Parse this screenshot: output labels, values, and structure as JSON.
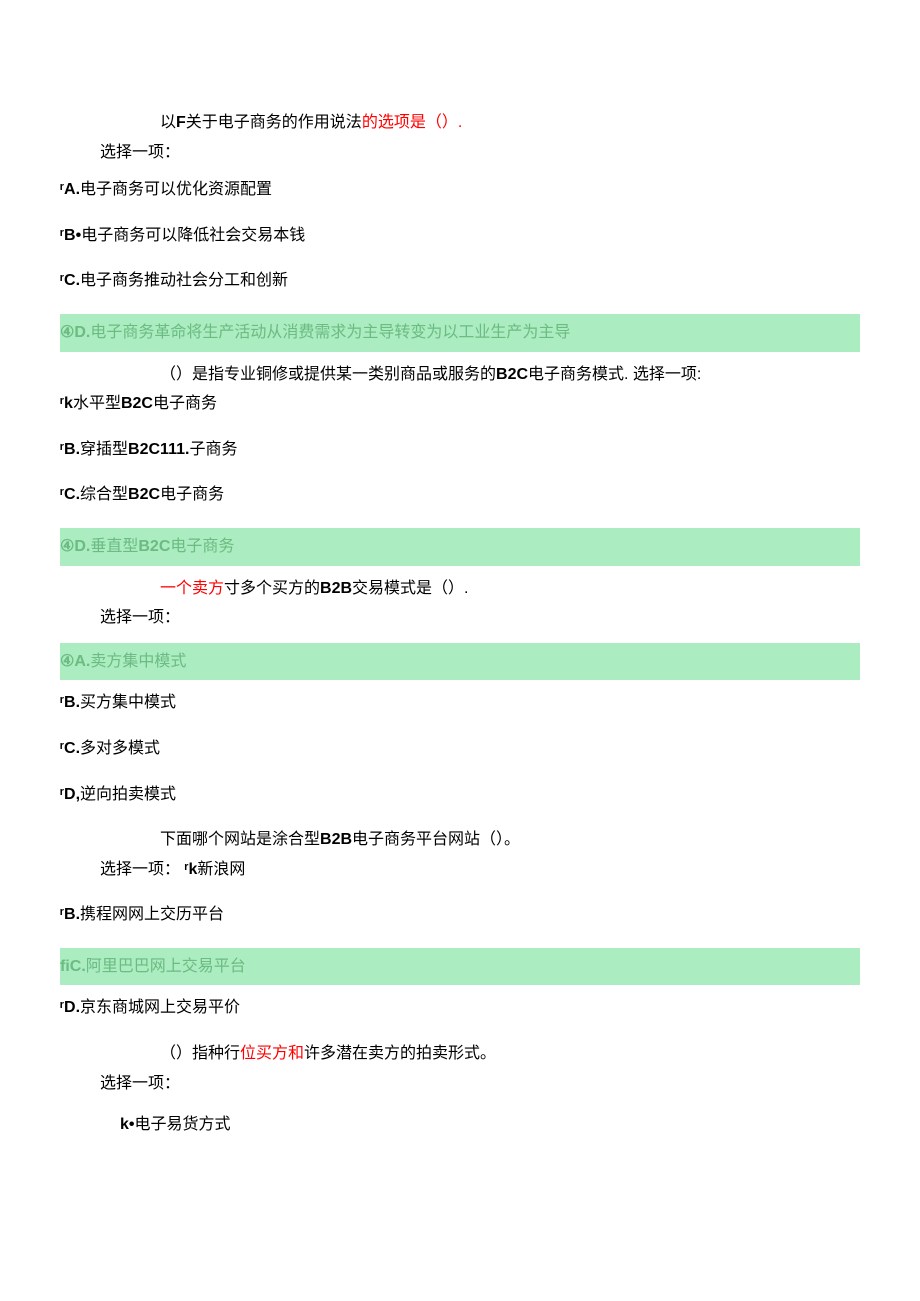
{
  "q1": {
    "text_pre": "以",
    "text_bold": "F",
    "text_mid": "关于电子商务的作用说法",
    "text_red": "的选项是（）.",
    "select": "选择一项：",
    "optA_label": "ʳA.",
    "optA_text": "电子商务可以优化资源配置",
    "optB_label": "ʳB•",
    "optB_text": "电子商务可以降低社会交易本钱",
    "optC_label": "ʳC.",
    "optC_text": "电子商务推动社会分工和创新",
    "optD_label": "④D.",
    "optD_text": "电子商务革命将生产活动从消费需求为主导转变为以工业生产为主导"
  },
  "q2": {
    "text_pre": "（）是指专业铜修或提供某一类别商品或服务的",
    "text_bold": "B2C",
    "text_mid": "电子商务模式. 选择一项:",
    "optA_label": "ʳk",
    "optA_text_pre": "水平型",
    "optA_text_bold": "B2C",
    "optA_text_post": "电子商务",
    "optB_label": "ʳB.",
    "optB_text_pre": "穿插型",
    "optB_text_bold": "B2C111.",
    "optB_text_post": "子商务",
    "optC_label": "ʳC.",
    "optC_text_pre": "综合型",
    "optC_text_bold": "B2C",
    "optC_text_post": "电子商务",
    "optD_label": "④D.",
    "optD_text_pre": "垂直型",
    "optD_text_bold": "B2C",
    "optD_text_post": "电子商务"
  },
  "q3": {
    "text_red": "一个卖方",
    "text_mid": "寸多个买方的",
    "text_bold": "B2B",
    "text_post": "交易模式是（）.",
    "select": "选择一项：",
    "optA_label": "④A.",
    "optA_text": "卖方集中模式",
    "optB_label": "ʳB.",
    "optB_text": "买方集中模式",
    "optC_label": "ʳC.",
    "optC_text": "多对多模式",
    "optD_label": "ʳD,",
    "optD_text": "逆向拍卖模式"
  },
  "q4": {
    "text_pre": "下面哪个网站是涂合型",
    "text_bold": "B2B",
    "text_post": "电子商务平台网站（）。",
    "select_pre": "选择一项：",
    "optA_label": "ʳk",
    "optA_text": "新浪网",
    "optB_label": "ʳB.",
    "optB_text": "携程网网上交历平台",
    "optC_label": "ﬁC.",
    "optC_text": "阿里巴巴网上交易平台",
    "optD_label": "ʳD.",
    "optD_text": "京东商城网上交易平价"
  },
  "q5": {
    "text_pre": "（）指种行",
    "text_red": "位买方和",
    "text_post": "许多潜在卖方的拍卖形式。",
    "select": "选择一项：",
    "optA_label": "k•",
    "optA_text": "电子易货方式"
  }
}
